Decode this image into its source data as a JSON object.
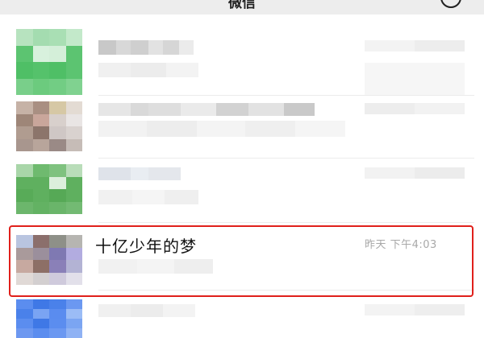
{
  "header": {
    "title": "微信"
  },
  "chats": [
    {
      "name": "",
      "time": "",
      "avatar_color": "#5cc471"
    },
    {
      "name": "",
      "time": "",
      "avatar_color": "#b49a8a"
    },
    {
      "name": "",
      "time": "",
      "avatar_color": "#5fb05f"
    },
    {
      "name": "十亿少年的梦",
      "time": "昨天 下午4:03",
      "avatar_color": "#9b8f9c",
      "highlighted": true
    },
    {
      "name": "",
      "time": "",
      "avatar_color": "#5b8def"
    }
  ],
  "colors": {
    "highlight_border": "#e0201b",
    "header_bg": "#ededed"
  }
}
